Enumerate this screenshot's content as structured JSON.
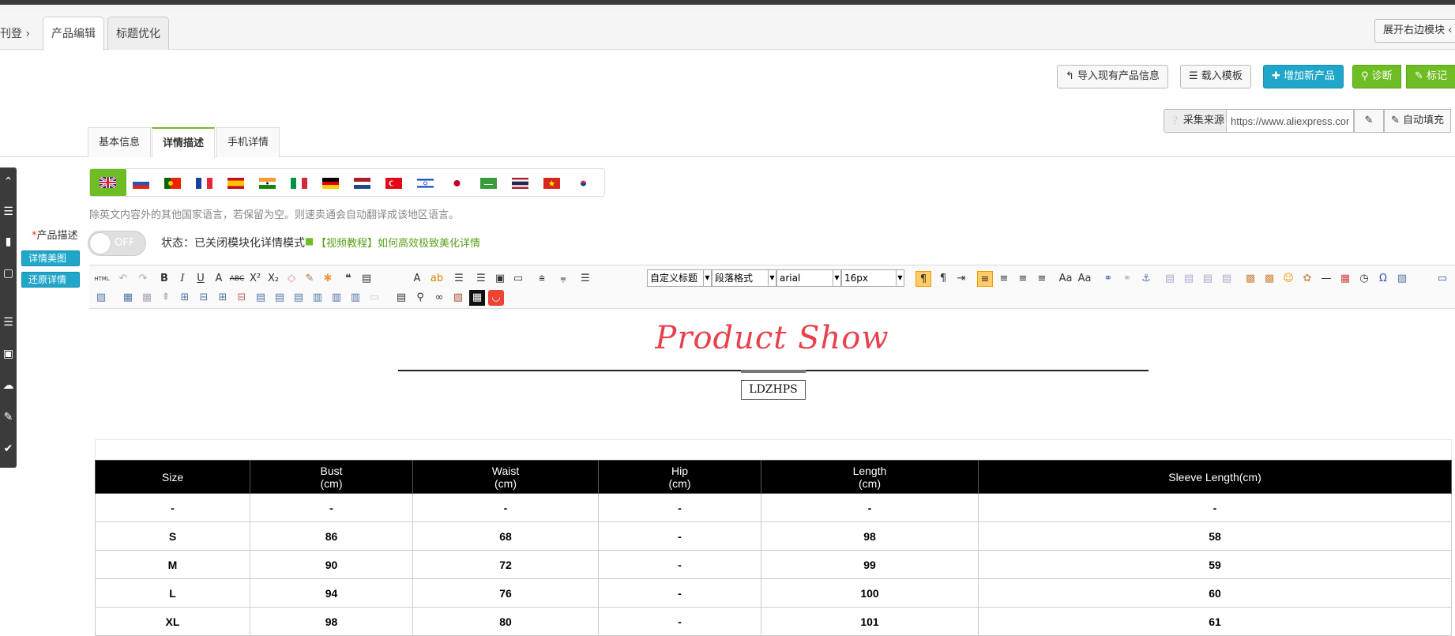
{
  "tabs": {
    "breadcrumb_prefix": "刊登",
    "items": [
      "产品编辑",
      "标题优化"
    ],
    "expand_right": "展开右边模块"
  },
  "actions": {
    "import": "导入现有产品信息",
    "template": "载入模板",
    "add_product": "增加新产品",
    "diagnose": "诊断",
    "mark": "标记"
  },
  "source": {
    "label": "采集来源",
    "url": "https://www.aliexpress.com",
    "autofill": "自动填充"
  },
  "sub_tabs": [
    "基本信息",
    "详情描述",
    "手机详情"
  ],
  "colors": {
    "accent_green": "#6fbd24",
    "accent_blue": "#1fa6c8",
    "title_red": "#e8414d"
  },
  "lang_hint": "除英文内容外的其他国家语言，若保留为空。则速卖通会自动翻译成该地区语言。",
  "desc": {
    "label": "产品描述",
    "required_mark": "*",
    "beautify_btn": "详情美图",
    "restore_btn": "还原详情",
    "toggle": "OFF",
    "status": "状态：已关闭模块化详情模式",
    "tutorial": "【视频教程】如何高效极致美化详情"
  },
  "toolbar": {
    "html": "HTML",
    "heading": "自定义标题",
    "paragraph": "段落格式",
    "font": "arial",
    "size": "16px"
  },
  "content": {
    "title": "Product Show",
    "brand": "LDZHPS"
  },
  "size_table": {
    "headers": [
      [
        "Size"
      ],
      [
        "Bust",
        "(cm)"
      ],
      [
        "Waist",
        "(cm)"
      ],
      [
        "Hip",
        "(cm)"
      ],
      [
        "Length",
        "(cm)"
      ],
      [
        "Sleeve Length(cm)"
      ]
    ],
    "rows": [
      [
        "-",
        "-",
        "-",
        "-",
        "-",
        "-"
      ],
      [
        "S",
        "86",
        "68",
        "-",
        "98",
        "58"
      ],
      [
        "M",
        "90",
        "72",
        "-",
        "99",
        "59"
      ],
      [
        "L",
        "94",
        "76",
        "-",
        "100",
        "60"
      ],
      [
        "XL",
        "98",
        "80",
        "-",
        "101",
        "61"
      ]
    ]
  }
}
